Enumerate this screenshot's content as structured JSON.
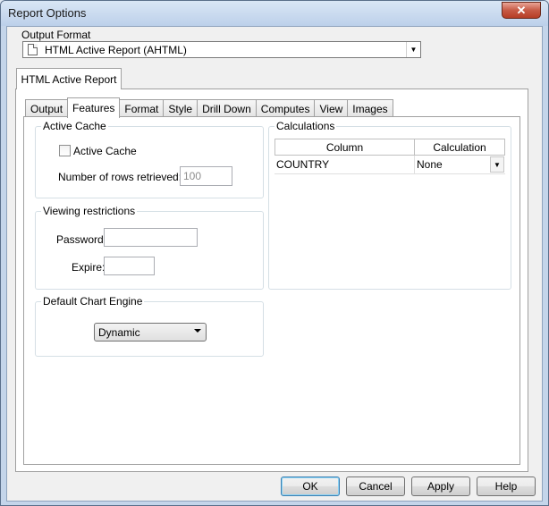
{
  "window": {
    "title": "Report Options",
    "close_glyph": "✕"
  },
  "output_format": {
    "label": "Output Format",
    "selected": "HTML Active Report (AHTML)"
  },
  "outer_tab": {
    "label": "HTML Active Report"
  },
  "tabs": [
    {
      "label": "Output"
    },
    {
      "label": "Features",
      "active": true
    },
    {
      "label": "Format"
    },
    {
      "label": "Style"
    },
    {
      "label": "Drill Down"
    },
    {
      "label": "Computes"
    },
    {
      "label": "View"
    },
    {
      "label": "Images"
    }
  ],
  "active_cache": {
    "title": "Active Cache",
    "checkbox_label": "Active Cache",
    "checked": false,
    "rows_label": "Number of rows retrieved:",
    "rows_value": "100"
  },
  "viewing_restrictions": {
    "title": "Viewing restrictions",
    "password_label": "Password:",
    "password_value": "",
    "expire_label": "Expire:",
    "expire_value": ""
  },
  "chart_engine": {
    "title": "Default Chart Engine",
    "selected": "Dynamic"
  },
  "calculations": {
    "title": "Calculations",
    "columns": [
      "Column",
      "Calculation"
    ],
    "rows": [
      {
        "column": "COUNTRY",
        "calculation": "None"
      }
    ]
  },
  "buttons": {
    "ok": "OK",
    "cancel": "Cancel",
    "apply": "Apply",
    "help": "Help"
  }
}
